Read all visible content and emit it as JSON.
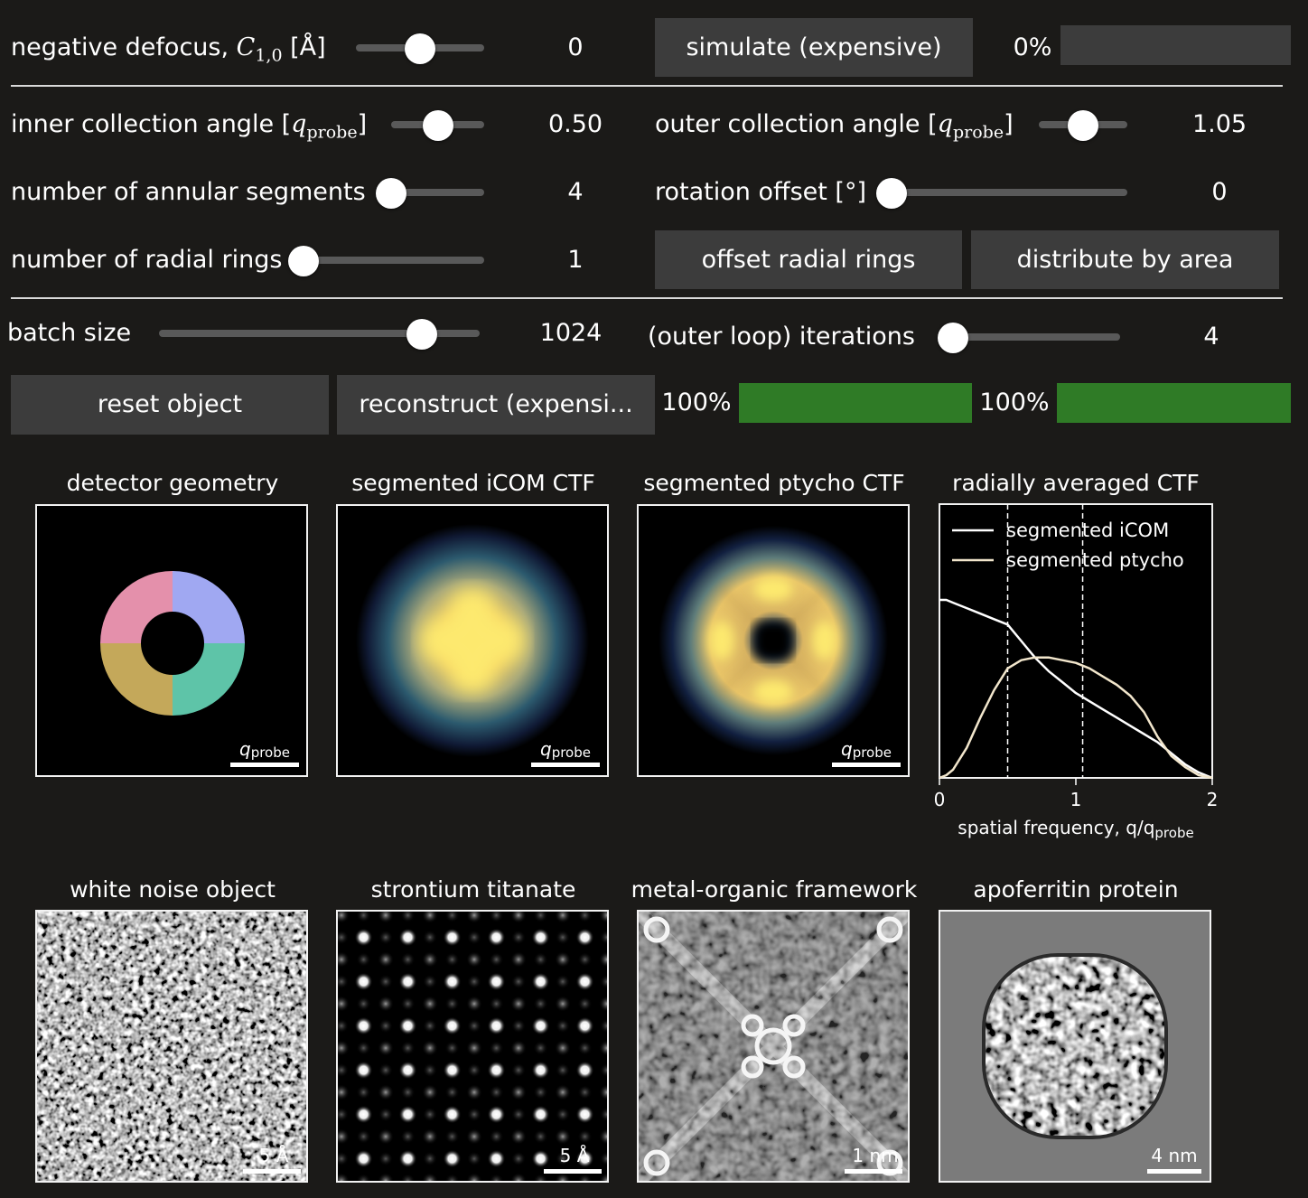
{
  "controls": {
    "defocus": {
      "label_text": "negative defocus, ",
      "symbol": "C",
      "subscript": "1,0",
      "unit": " [Å]",
      "value": "0",
      "slider_fraction": 0.5
    },
    "simulate": {
      "button": "simulate (expensive)",
      "progress": "0%",
      "progress_fraction": 0.0
    },
    "inner_angle": {
      "label_text": "inner collection angle [",
      "symbol": "q",
      "subscript": "probe",
      "close": "]",
      "value": "0.50",
      "slider_fraction": 0.5
    },
    "outer_angle": {
      "label_text": "outer collection angle [",
      "symbol": "q",
      "subscript": "probe",
      "close": "]",
      "value": "1.05",
      "slider_fraction": 0.5
    },
    "segments": {
      "label": "number of annular segments",
      "value": "4",
      "slider_fraction": 0.0
    },
    "rotation": {
      "label": "rotation offset [°]",
      "value": "0",
      "slider_fraction": 0.0
    },
    "rings": {
      "label": "number of radial rings",
      "value": "1",
      "slider_fraction": 0.0
    },
    "offset_rings_button": "offset radial rings",
    "distribute_button": "distribute by area",
    "batch": {
      "label": "batch size",
      "value": "1024",
      "slider_fraction": 0.82
    },
    "iterations": {
      "label": "(outer loop) iterations",
      "value": "4",
      "slider_fraction": 0.0
    },
    "reset_button": "reset object",
    "reconstruct_button": "reconstruct (expensi...",
    "progress1": {
      "text": "100%",
      "fraction": 1.0
    },
    "progress2": {
      "text": "100%",
      "fraction": 1.0
    },
    "colors": {
      "progress_fill": "#2f7b26",
      "panel_bg": "#1b1a18",
      "button_bg": "#3c3c3c"
    }
  },
  "panels": {
    "detector": {
      "title": "detector geometry",
      "scalebar": "q",
      "scalebar_sub": "probe",
      "segment_colors": [
        "#a0a8f2",
        "#5ec4a8",
        "#c4a85a",
        "#e490ab"
      ]
    },
    "icom": {
      "title": "segmented iCOM CTF",
      "scalebar": "q",
      "scalebar_sub": "probe"
    },
    "ptycho": {
      "title": "segmented ptycho CTF",
      "scalebar": "q",
      "scalebar_sub": "probe"
    },
    "noise": {
      "title": "white noise object",
      "scalebar": "5 Å"
    },
    "srtio3": {
      "title": "strontium titanate",
      "scalebar": "5 Å"
    },
    "mof": {
      "title": "metal-organic framework",
      "scalebar": "1 nm"
    },
    "apoferritin": {
      "title": "apoferritin protein",
      "scalebar": "4 nm"
    }
  },
  "chart_data": {
    "type": "line",
    "title": "radially averaged CTF",
    "xlabel": "spatial frequency, q/q",
    "xlabel_sub": "probe",
    "xlim": [
      0,
      2
    ],
    "ylim": [
      0,
      1
    ],
    "xticks": [
      "0",
      "1",
      "2"
    ],
    "legend_position": "top-left",
    "vlines": [
      0.5,
      1.05
    ],
    "series": [
      {
        "name": "segmented iCOM",
        "color": "#ffffff",
        "x": [
          0,
          0.05,
          0.1,
          0.2,
          0.3,
          0.4,
          0.5,
          0.6,
          0.7,
          0.8,
          0.9,
          1.0,
          1.1,
          1.2,
          1.3,
          1.4,
          1.5,
          1.6,
          1.7,
          1.8,
          1.9,
          2.0
        ],
        "y": [
          0.65,
          0.65,
          0.64,
          0.62,
          0.6,
          0.58,
          0.56,
          0.5,
          0.44,
          0.39,
          0.35,
          0.31,
          0.28,
          0.25,
          0.22,
          0.19,
          0.16,
          0.13,
          0.09,
          0.05,
          0.02,
          0.0
        ]
      },
      {
        "name": "segmented ptycho",
        "color": "#f2e6cc",
        "x": [
          0,
          0.05,
          0.1,
          0.2,
          0.3,
          0.4,
          0.5,
          0.6,
          0.7,
          0.8,
          0.9,
          1.0,
          1.1,
          1.2,
          1.3,
          1.4,
          1.5,
          1.6,
          1.7,
          1.8,
          1.9,
          2.0
        ],
        "y": [
          0.0,
          0.01,
          0.03,
          0.11,
          0.22,
          0.32,
          0.4,
          0.43,
          0.44,
          0.44,
          0.43,
          0.42,
          0.4,
          0.37,
          0.34,
          0.3,
          0.24,
          0.15,
          0.08,
          0.04,
          0.01,
          0.0
        ]
      }
    ]
  }
}
